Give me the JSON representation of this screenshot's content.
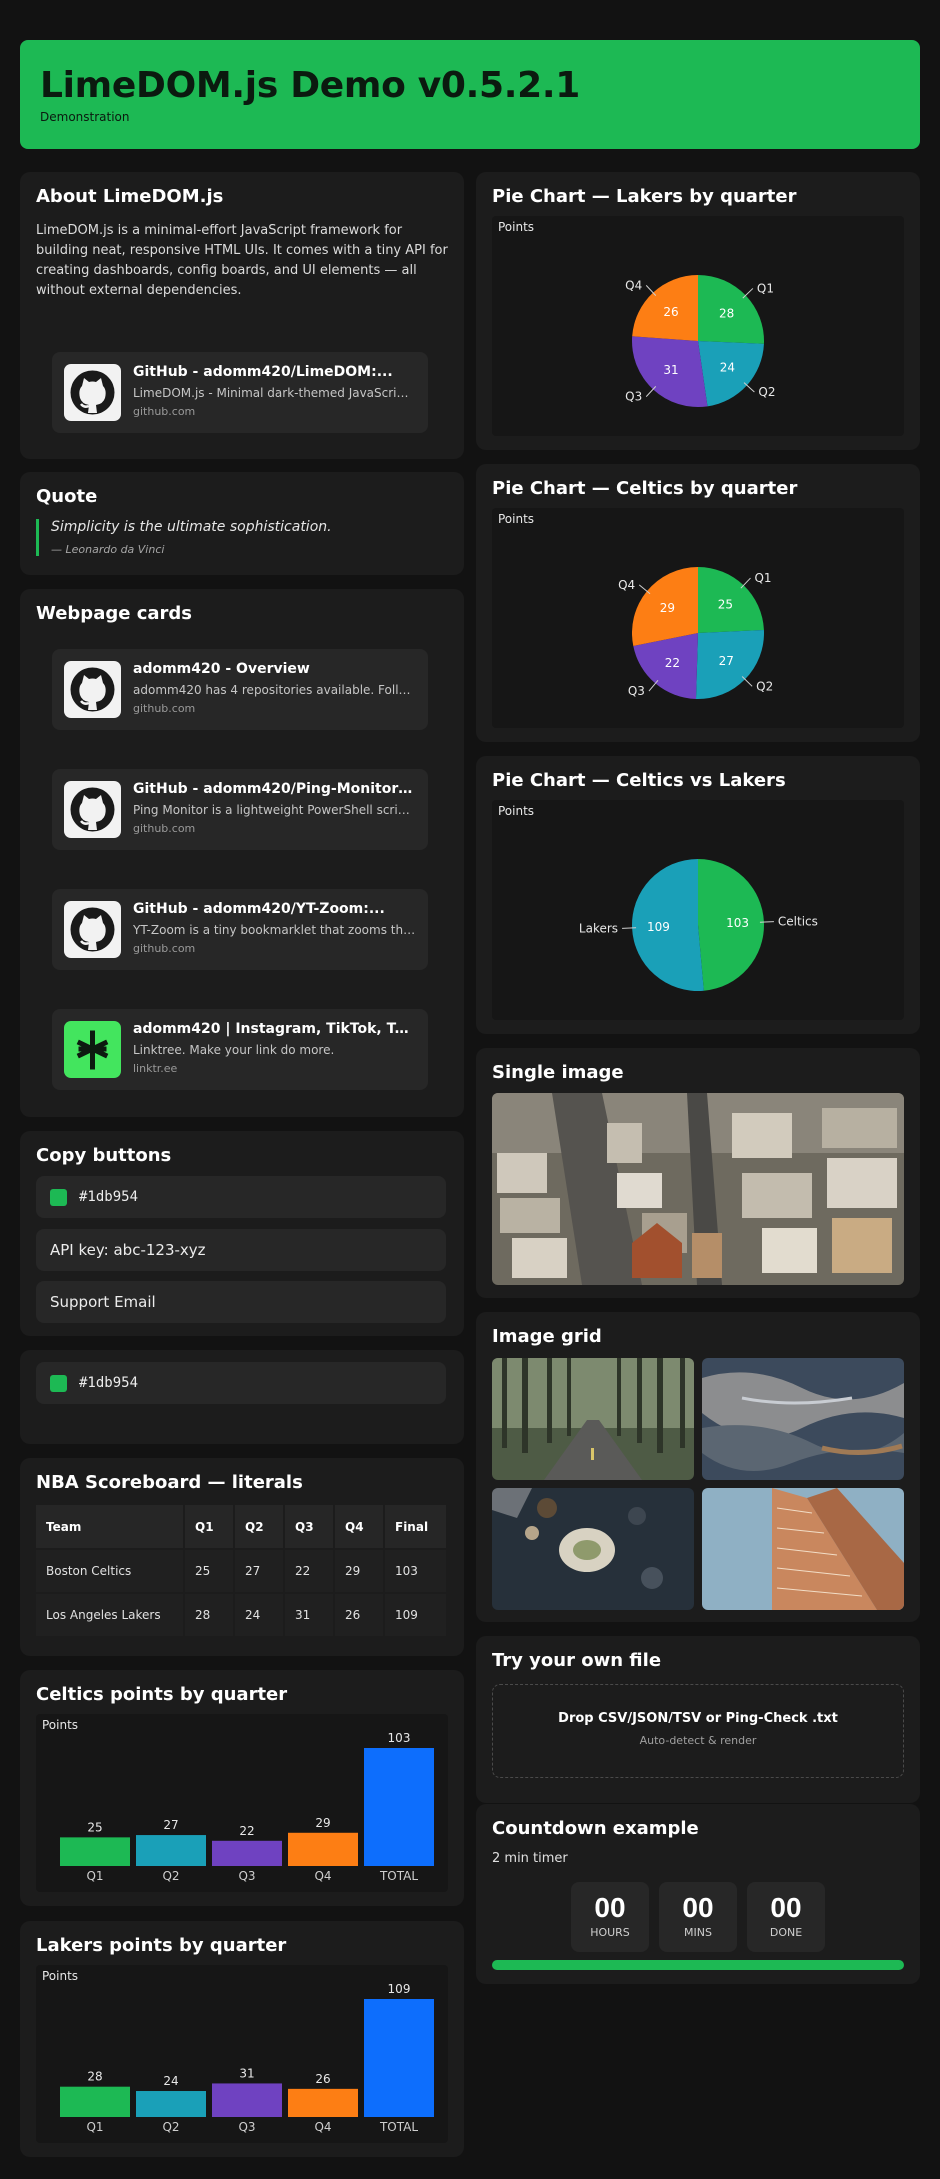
{
  "header": {
    "title": "LimeDOM.js Demo v0.5.2.1",
    "subtitle": "Demonstration"
  },
  "about": {
    "title": "About LimeDOM.js",
    "text": "LimeDOM.js is a minimal-effort JavaScript framework for building neat, responsive HTML UIs. It comes with a tiny API for creating dashboards, config boards, and UI elements — all without external dependencies.",
    "link": {
      "title": "GitHub - adomm420/LimeDOM:...",
      "desc": "LimeDOM.js - Minimal dark-themed JavaScript ...",
      "domain": "github.com",
      "icon": "github-icon"
    }
  },
  "quote": {
    "title": "Quote",
    "text": "Simplicity is the ultimate sophistication.",
    "author": "— Leonardo da Vinci"
  },
  "webcards": {
    "title": "Webpage cards",
    "items": [
      {
        "title": "adomm420 - Overview",
        "desc": "adomm420 has 4 repositories available. Follow...",
        "domain": "github.com",
        "icon": "github-icon"
      },
      {
        "title": "GitHub - adomm420/Ping-Monitor:...",
        "desc": "Ping Monitor is a lightweight PowerShell script...",
        "domain": "github.com",
        "icon": "github-icon"
      },
      {
        "title": "GitHub - adomm420/YT-Zoom:...",
        "desc": "YT-Zoom is a tiny bookmarklet that zooms the...",
        "domain": "github.com",
        "icon": "github-icon"
      },
      {
        "title": "adomm420 | Instagram, TikTok, Twitc...",
        "desc": "Linktree. Make your link do more.",
        "domain": "linktr.ee",
        "icon": "linktree-icon"
      }
    ]
  },
  "copy": {
    "title": "Copy buttons",
    "color": "#1db954",
    "color_label": "#1db954",
    "api": "API key: abc-123-xyz",
    "email": "Support Email",
    "color2_label": "#1db954"
  },
  "scoreboard": {
    "title": "NBA Scoreboard — literals",
    "headers": [
      "Team",
      "Q1",
      "Q2",
      "Q3",
      "Q4",
      "Final"
    ],
    "rows": [
      [
        "Boston Celtics",
        "25",
        "27",
        "22",
        "29",
        "103"
      ],
      [
        "Los Angeles Lakers",
        "28",
        "24",
        "31",
        "26",
        "109"
      ]
    ]
  },
  "colors": {
    "q1": "#1db954",
    "q2": "#1aa0b8",
    "q3": "#6f42c1",
    "q4": "#fd7e14",
    "total": "#0d6efd",
    "accent": "#1db954"
  },
  "celtics_bar": {
    "title": "Celtics points by quarter",
    "points_label": "Points"
  },
  "lakers_bar": {
    "title": "Lakers points by quarter",
    "points_label": "Points"
  },
  "pie_lakers": {
    "title": "Pie Chart — Lakers by quarter",
    "points_label": "Points"
  },
  "pie_celtics": {
    "title": "Pie Chart — Celtics by quarter",
    "points_label": "Points"
  },
  "pie_vs": {
    "title": "Pie Chart — Celtics vs Lakers",
    "points_label": "Points"
  },
  "single_image": {
    "title": "Single image"
  },
  "image_grid": {
    "title": "Image grid"
  },
  "file": {
    "title": "Try your own file",
    "drop_title": "Drop CSV/JSON/TSV or Ping-Check .txt",
    "drop_sub": "Auto-detect & render"
  },
  "countdown": {
    "title": "Countdown example",
    "subtitle": "2 min timer",
    "hours": "00",
    "hours_label": "HOURS",
    "mins": "00",
    "mins_label": "MINS",
    "done": "00",
    "done_label": "DONE",
    "progress": 1.0
  },
  "chart_data": [
    {
      "type": "bar",
      "title": "Celtics points by quarter",
      "ylabel": "Points",
      "categories": [
        "Q1",
        "Q2",
        "Q3",
        "Q4",
        "TOTAL"
      ],
      "values": [
        25,
        27,
        22,
        29,
        103
      ]
    },
    {
      "type": "bar",
      "title": "Lakers points by quarter",
      "ylabel": "Points",
      "categories": [
        "Q1",
        "Q2",
        "Q3",
        "Q4",
        "TOTAL"
      ],
      "values": [
        28,
        24,
        31,
        26,
        109
      ]
    },
    {
      "type": "pie",
      "title": "Pie Chart — Lakers by quarter",
      "ylabel": "Points",
      "categories": [
        "Q1",
        "Q2",
        "Q3",
        "Q4"
      ],
      "values": [
        28,
        24,
        31,
        26
      ]
    },
    {
      "type": "pie",
      "title": "Pie Chart — Celtics by quarter",
      "ylabel": "Points",
      "categories": [
        "Q1",
        "Q2",
        "Q3",
        "Q4"
      ],
      "values": [
        25,
        27,
        22,
        29
      ]
    },
    {
      "type": "pie",
      "title": "Pie Chart — Celtics vs Lakers",
      "ylabel": "Points",
      "categories": [
        "Celtics",
        "Lakers"
      ],
      "values": [
        103,
        109
      ]
    }
  ]
}
